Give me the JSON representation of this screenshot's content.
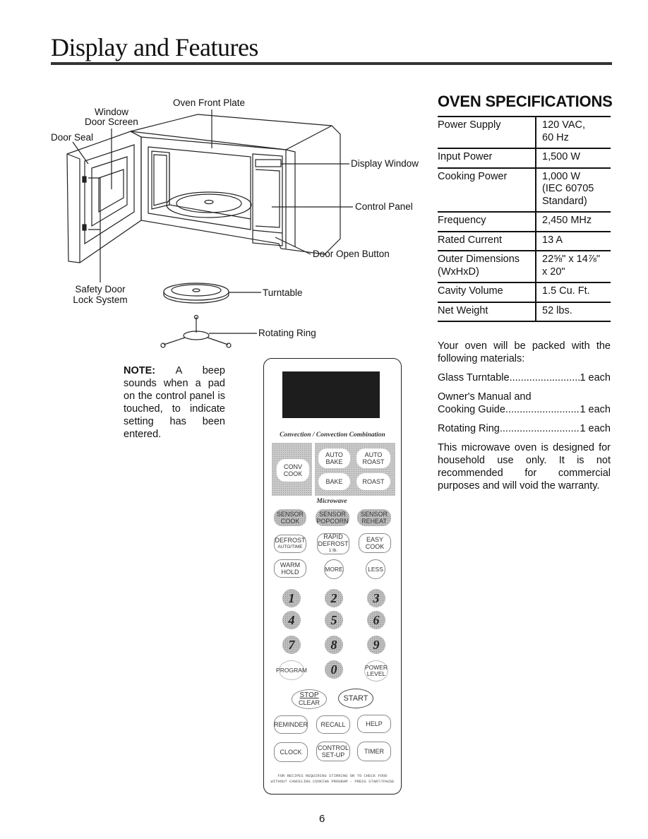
{
  "page": {
    "title": "Display and Features",
    "page_number": "6"
  },
  "diagram": {
    "labels": {
      "oven_front_plate": "Oven Front Plate",
      "window": "Window",
      "door_screen": "Door Screen",
      "door_seal": "Door Seal",
      "display_window": "Display Window",
      "control_panel": "Control Panel",
      "door_open_button": "Door Open Button",
      "safety_door": "Safety Door",
      "lock_system": "Lock System",
      "turntable": "Turntable",
      "rotating_ring": "Rotating Ring"
    }
  },
  "note": {
    "heading": "NOTE:",
    "text": " A beep sounds when a pad on the control panel is touched, to indicate setting has been entered."
  },
  "specs": {
    "title": "OVEN SPECIFICATIONS",
    "rows": [
      {
        "key": "Power Supply",
        "value": [
          "120 VAC,",
          "60 Hz"
        ]
      },
      {
        "key": "Input Power",
        "value": [
          "1,500 W"
        ]
      },
      {
        "key": "Cooking Power",
        "value": [
          "1,000 W",
          "(IEC 60705",
          "Standard)"
        ]
      },
      {
        "key": "Frequency",
        "value": [
          "2,450 MHz"
        ]
      },
      {
        "key": "Rated Current",
        "value": [
          "13 A"
        ]
      },
      {
        "key": "Outer Dimensions (WxHxD)",
        "key_lines": [
          "Outer Dimensions",
          "(WxHxD)"
        ],
        "value": [
          "22⅝\" x 14⅞\"",
          "x 20\""
        ]
      },
      {
        "key": "Cavity Volume",
        "value": [
          "1.5 Cu. Ft."
        ]
      },
      {
        "key": "Net Weight",
        "value": [
          "52 lbs."
        ]
      }
    ]
  },
  "packing": {
    "intro": "Your oven will be packed with the following materials:",
    "items": [
      {
        "pre": "",
        "name": "Glass Turntable",
        "qty": "1 each"
      },
      {
        "pre": "Owner's Manual and",
        "name": "Cooking Guide",
        "qty": "1 each"
      },
      {
        "pre": "",
        "name": "Rotating Ring",
        "qty": "1 each"
      }
    ],
    "disclaimer": "This microwave oven is designed for household use only. It is not recommended for commercial purposes and will void the warranty."
  },
  "control_panel": {
    "convection_label": "Convection / Convection Combination",
    "microwave_label": "Microwave",
    "conv_pads": {
      "conv_cook": "CONV COOK",
      "auto_bake": "AUTO BAKE",
      "auto_roast": "AUTO ROAST",
      "bake": "BAKE",
      "roast": "ROAST"
    },
    "sensor_pads": [
      "SENSOR COOK",
      "SENSOR POPCORN",
      "SENSOR REHEAT"
    ],
    "defrost": {
      "main": "DEFROST",
      "sub": "AUTO/TIME"
    },
    "rapid_defrost": {
      "main": "RAPID DEFROST",
      "sub": "1 lb."
    },
    "easy_cook": "EASY COOK",
    "warm_hold": "WARM HOLD",
    "more": "MORE",
    "less": "LESS",
    "digits": [
      "1",
      "2",
      "3",
      "4",
      "5",
      "6",
      "7",
      "8",
      "9",
      "0"
    ],
    "program": "PROGRAM",
    "power_level": "POWER LEVEL",
    "stop": "STOP",
    "clear": "CLEAR",
    "start": "START",
    "reminder": "REMINDER",
    "recall": "RECALL",
    "help": "HELP",
    "clock": "CLOCK",
    "control_setup": "CONTROL SET-UP",
    "timer": "TIMER",
    "footer_note": "FOR RECIPES REQUIRING STIRRING OR TO CHECK FOOD WITHOUT CANCELING COOKING PROGRAM - PRESS START/PAUSE"
  }
}
